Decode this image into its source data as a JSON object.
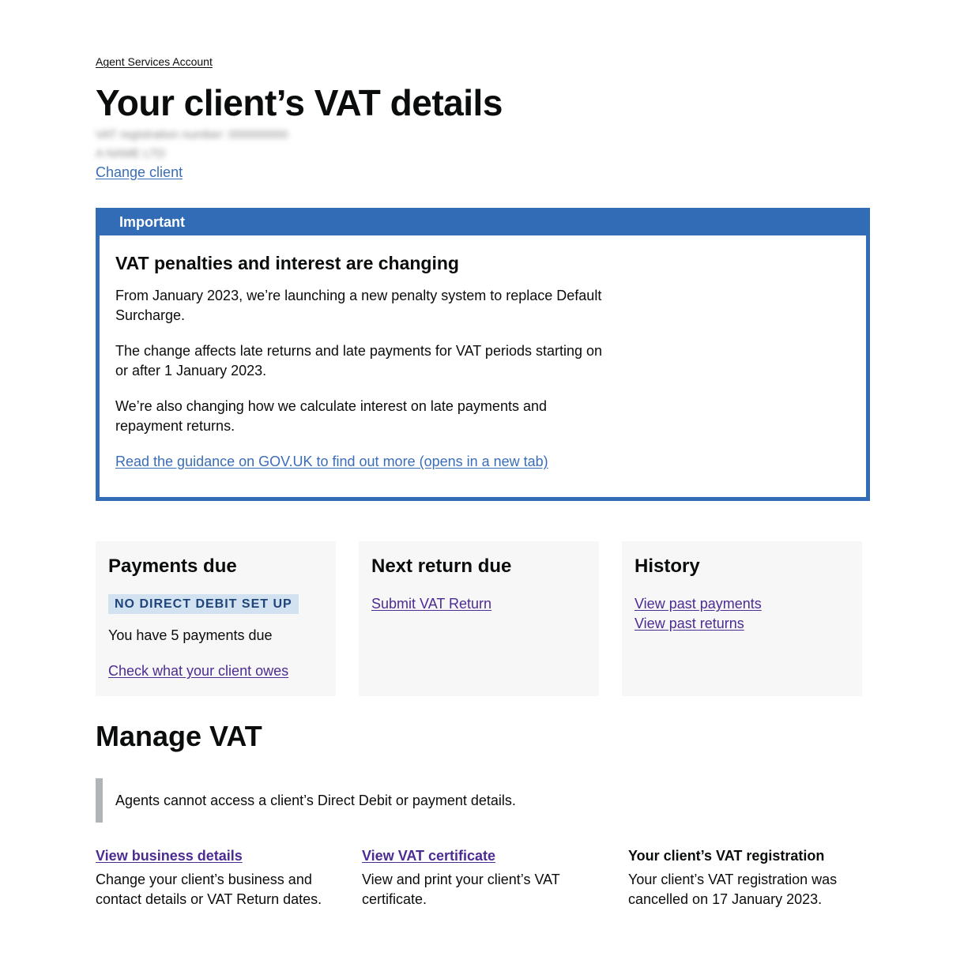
{
  "breadcrumb": {
    "label": "Agent Services Account"
  },
  "header": {
    "title": "Your client’s VAT details",
    "client_info_line1": "VAT registration number: 000000000",
    "client_info_line2": "A NAME LTD",
    "change_client_label": "Change client"
  },
  "banner": {
    "label": "Important",
    "heading": "VAT penalties and interest are changing",
    "paragraphs": [
      "From January 2023, we’re launching a new penalty system to replace Default Surcharge.",
      "The change affects late returns and late payments for VAT periods starting on or after 1 January 2023.",
      "We’re also changing how we calculate interest on late payments and repayment returns."
    ],
    "link_label": "Read the guidance on GOV.UK to find out more (opens in a new tab)",
    "color": "#336cb6"
  },
  "cards": {
    "payments": {
      "title": "Payments due",
      "tag": "NO DIRECT DEBIT SET UP",
      "text": "You have 5 payments due",
      "link": "Check what your client owes"
    },
    "next_return": {
      "title": "Next return due",
      "link": "Submit VAT Return"
    },
    "history": {
      "title": "History",
      "links": [
        "View past payments",
        "View past returns"
      ]
    }
  },
  "manage": {
    "title": "Manage VAT",
    "inset_text": "Agents cannot access a client’s Direct Debit or payment details.",
    "items": [
      {
        "link": "View business details",
        "description": "Change your client’s business and contact details or VAT Return dates."
      },
      {
        "link": "View VAT certificate",
        "description": "View and print your client’s VAT certificate."
      },
      {
        "heading": "Your client’s VAT registration",
        "description": "Your client’s VAT registration was cancelled on 17 January 2023."
      }
    ]
  },
  "colors": {
    "link": "#3a6db8",
    "visited_link": "#4c2c92",
    "card_background": "#f7f7f7",
    "tag_background": "#d2e2f1",
    "tag_text": "#1e4478"
  }
}
